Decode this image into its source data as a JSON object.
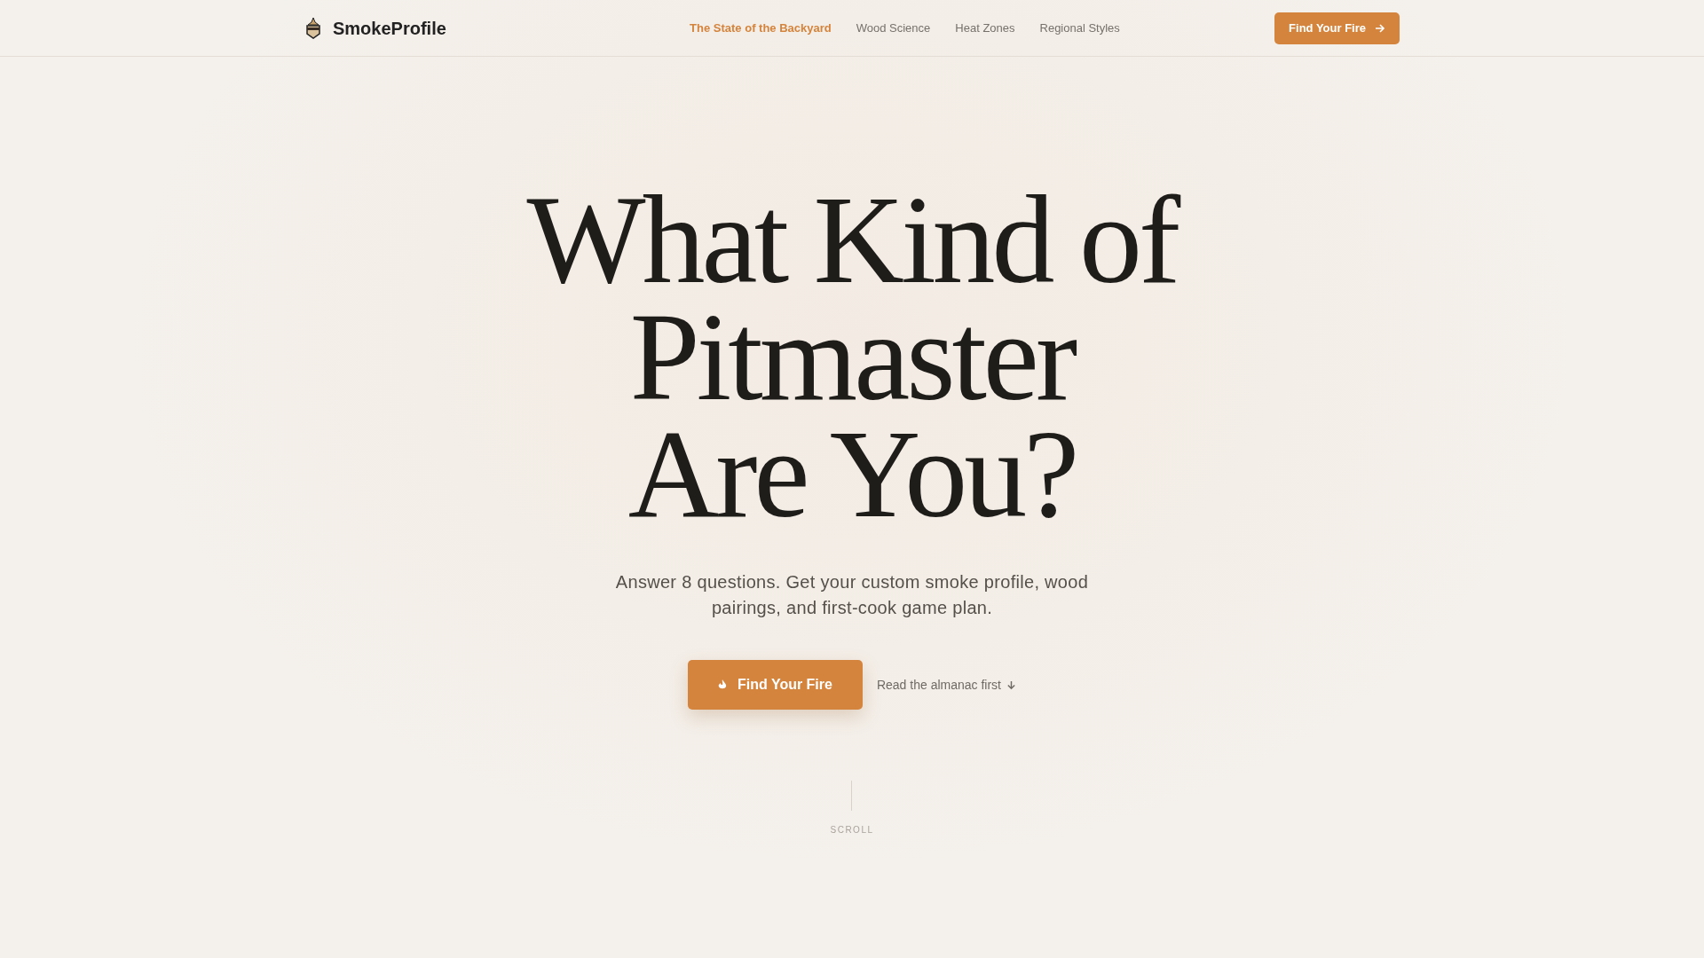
{
  "brand": {
    "name": "SmokeProfile"
  },
  "nav": [
    {
      "label": "The State of the Backyard",
      "selected": true
    },
    {
      "label": "Wood Science",
      "selected": false
    },
    {
      "label": "Heat Zones",
      "selected": false
    },
    {
      "label": "Regional Styles",
      "selected": false
    }
  ],
  "header_button": {
    "label": "Find Your Fire"
  },
  "hero": {
    "title_lines": [
      "What Kind of",
      "Pitmaster",
      "Are You?"
    ],
    "subtitle": "Answer 8 questions. Get your custom smoke profile, wood pairings, and first-cook game plan.",
    "primary_button": {
      "label": "Find Your Fire"
    },
    "secondary_link": {
      "label": "Read the almanac first"
    }
  },
  "scroll_label": "SCROLL"
}
